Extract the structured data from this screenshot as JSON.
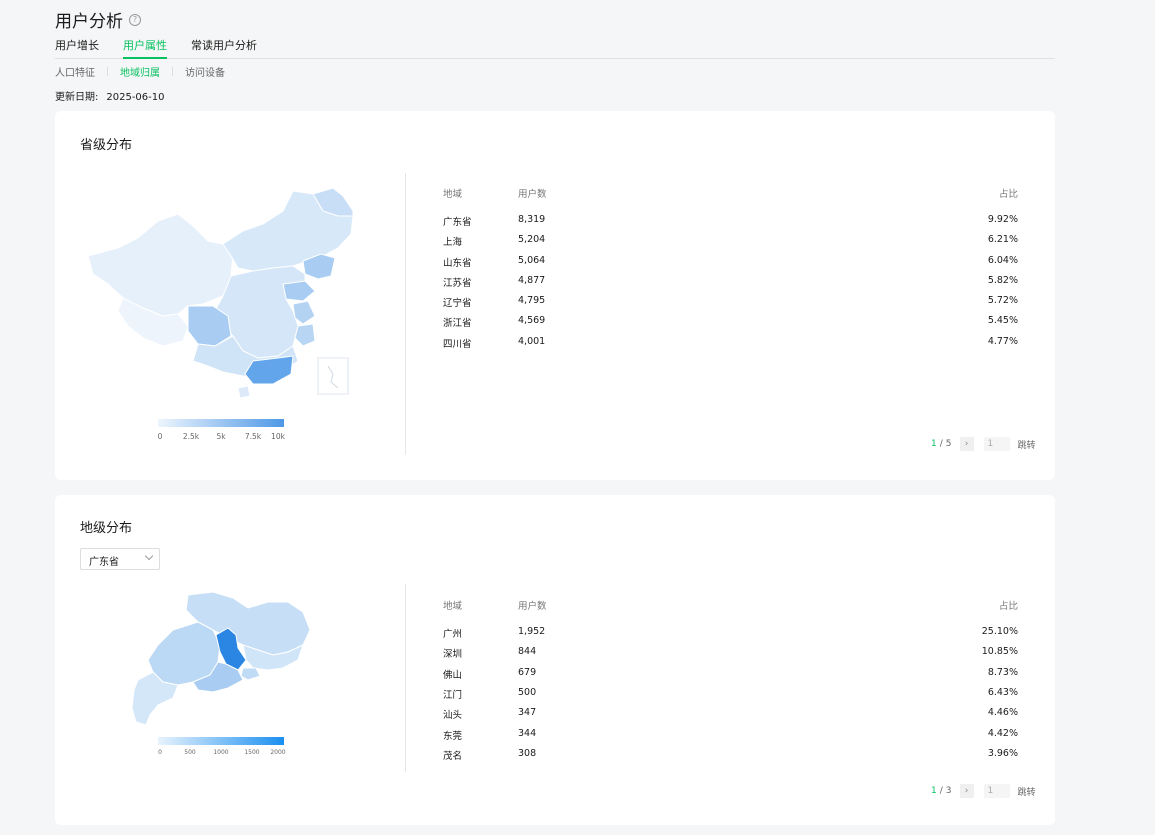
{
  "page": {
    "title": "用户分析",
    "help_icon": "?"
  },
  "tabs": [
    {
      "label": "用户增长",
      "active": false
    },
    {
      "label": "用户属性",
      "active": true
    },
    {
      "label": "常读用户分析",
      "active": false
    }
  ],
  "subtabs": [
    {
      "label": "人口特征",
      "active": false
    },
    {
      "label": "地域归属",
      "active": true
    },
    {
      "label": "访问设备",
      "active": false
    }
  ],
  "update": {
    "label": "更新日期:",
    "date": "2025-06-10"
  },
  "province": {
    "title": "省级分布",
    "headers": {
      "region": "地域",
      "users": "用户数",
      "ratio": "占比"
    },
    "rows": [
      {
        "region": "广东省",
        "users": "8,319",
        "ratio": "9.92%"
      },
      {
        "region": "上海",
        "users": "5,204",
        "ratio": "6.21%"
      },
      {
        "region": "山东省",
        "users": "5,064",
        "ratio": "6.04%"
      },
      {
        "region": "江苏省",
        "users": "4,877",
        "ratio": "5.82%"
      },
      {
        "region": "辽宁省",
        "users": "4,795",
        "ratio": "5.72%"
      },
      {
        "region": "浙江省",
        "users": "4,569",
        "ratio": "5.45%"
      },
      {
        "region": "四川省",
        "users": "4,001",
        "ratio": "4.77%"
      }
    ],
    "pager": {
      "current": "1",
      "separator": "/",
      "total": "5",
      "next": "›",
      "input": "1",
      "jump": "跳转"
    },
    "legend": [
      "0",
      "2.5k",
      "5k",
      "7.5k",
      "10k"
    ]
  },
  "city": {
    "title": "地级分布",
    "select_value": "广东省",
    "headers": {
      "region": "地域",
      "users": "用户数",
      "ratio": "占比"
    },
    "rows": [
      {
        "region": "广州",
        "users": "1,952",
        "ratio": "25.10%"
      },
      {
        "region": "深圳",
        "users": "844",
        "ratio": "10.85%"
      },
      {
        "region": "佛山",
        "users": "679",
        "ratio": "8.73%"
      },
      {
        "region": "江门",
        "users": "500",
        "ratio": "6.43%"
      },
      {
        "region": "汕头",
        "users": "347",
        "ratio": "4.46%"
      },
      {
        "region": "东莞",
        "users": "344",
        "ratio": "4.42%"
      },
      {
        "region": "茂名",
        "users": "308",
        "ratio": "3.96%"
      }
    ],
    "pager": {
      "current": "1",
      "separator": "/",
      "total": "3",
      "next": "›",
      "input": "1",
      "jump": "跳转"
    },
    "legend": [
      "0",
      "500",
      "1000",
      "1500",
      "2000"
    ]
  },
  "colors": {
    "accent": "#07c160",
    "map_light": "#e3effb",
    "map_mid": "#a9cdf2",
    "map_dark": "#4d98e6"
  }
}
